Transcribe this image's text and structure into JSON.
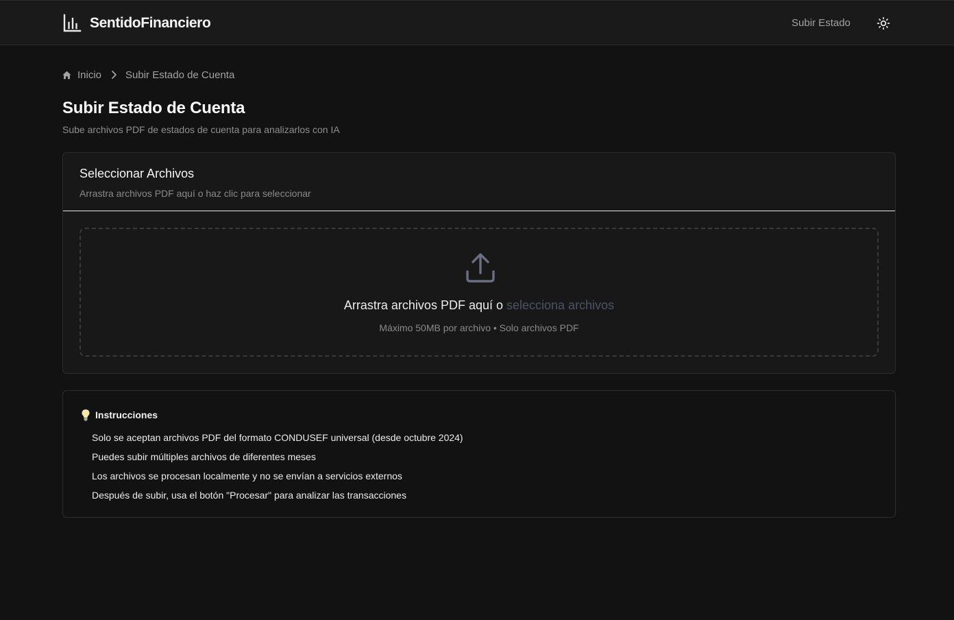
{
  "header": {
    "brand": "SentidoFinanciero",
    "brand_icon": "bar-chart-icon",
    "nav_upload": "Subir Estado",
    "theme_icon": "sun-icon"
  },
  "breadcrumb": {
    "home_icon": "home-icon",
    "home": "Inicio",
    "separator_icon": "chevron-right-icon",
    "current": "Subir Estado de Cuenta"
  },
  "page": {
    "title": "Subir Estado de Cuenta",
    "subtitle": "Sube archivos PDF de estados de cuenta para analizarlos con IA"
  },
  "upload_card": {
    "title": "Seleccionar Archivos",
    "description": "Arrastra archivos PDF aquí o haz clic para seleccionar",
    "dropzone": {
      "icon": "upload-icon",
      "text": "Arrastra archivos PDF aquí o ",
      "select_link": "selecciona archivos",
      "hint": "Máximo 50MB por archivo • Solo archivos PDF"
    }
  },
  "instructions": {
    "icon": "lightbulb-icon",
    "title": "Instrucciones",
    "items": [
      "Solo se aceptan archivos PDF del formato CONDUSEF universal (desde octubre 2024)",
      "Puedes subir múltiples archivos de diferentes meses",
      "Los archivos se procesan localmente y no se envían a servicios externos",
      "Después de subir, usa el botón \"Procesar\" para analizar las transacciones"
    ]
  },
  "colors": {
    "background": "#121212",
    "header_bg": "#1a1a1a",
    "card_bg": "#181818",
    "border": "#2c2c2c",
    "accent_link": "#4e5266",
    "muted_text": "#8a8a8a"
  }
}
